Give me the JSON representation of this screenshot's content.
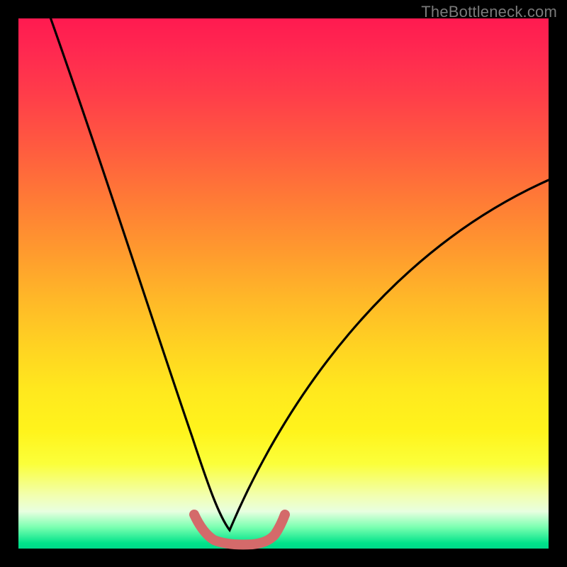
{
  "watermark": "TheBottleneck.com",
  "chart_data": {
    "type": "line",
    "title": "",
    "xlabel": "",
    "ylabel": "",
    "xlim": [
      0,
      100
    ],
    "ylim": [
      0,
      100
    ],
    "series": [
      {
        "name": "bottleneck-curve",
        "x": [
          0,
          5,
          10,
          15,
          20,
          25,
          28,
          30,
          32,
          34,
          36,
          38,
          40,
          42,
          44,
          48,
          55,
          62,
          70,
          78,
          86,
          94,
          100
        ],
        "values": [
          100,
          86,
          72,
          58,
          44,
          30,
          18,
          10,
          5,
          2,
          1,
          0,
          0,
          0,
          1,
          4,
          12,
          22,
          33,
          44,
          54,
          63,
          69
        ]
      },
      {
        "name": "optimal-band",
        "x": [
          30,
          32,
          34,
          36,
          38,
          40,
          42,
          44,
          46
        ],
        "values": [
          5,
          2,
          0.5,
          0,
          0,
          0,
          0.5,
          2,
          5
        ]
      }
    ],
    "gradient_zones": [
      {
        "name": "bad-top",
        "color": "#ff1f50",
        "position": 0
      },
      {
        "name": "mid-orange",
        "color": "#ff9a2e",
        "position": 45
      },
      {
        "name": "yellow",
        "color": "#ffe81e",
        "position": 72
      },
      {
        "name": "good-green",
        "color": "#00e28a",
        "position": 100
      }
    ]
  }
}
